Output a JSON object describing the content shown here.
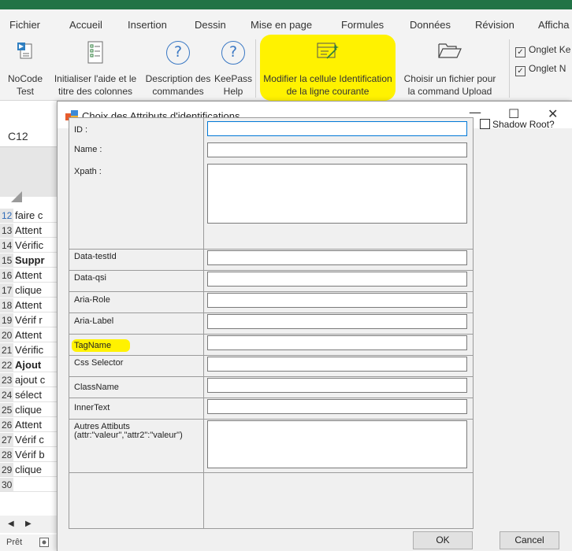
{
  "excel": {
    "menu_tabs": [
      "Fichier",
      "Accueil",
      "Insertion",
      "Dessin",
      "Mise en page",
      "Formules",
      "Données",
      "Révision",
      "Afficha"
    ],
    "ribbon": {
      "nocode_test": "NoCode\nTest",
      "init_help": "Initialiser l'aide et le\ntitre des colonnes",
      "desc_cmds": "Description des\ncommandes",
      "keepass_help": "KeePass\nHelp",
      "modify_cell": "Modifier la cellule Identification\nde la ligne courante",
      "choose_file": "Choisir un fichier pour\nla command Upload",
      "checkbox_1": "Onglet Ke",
      "checkbox_2": "Onglet N",
      "check_mark": "✓"
    },
    "name_box": "C12",
    "rows": [
      {
        "num": "12",
        "text": "faire c",
        "bold": false,
        "blue": true
      },
      {
        "num": "13",
        "text": "Attent",
        "bold": false,
        "blue": false
      },
      {
        "num": "14",
        "text": "Vérific",
        "bold": false,
        "blue": false
      },
      {
        "num": "15",
        "text": "Suppr",
        "bold": true,
        "blue": false
      },
      {
        "num": "16",
        "text": "Attent",
        "bold": false,
        "blue": false
      },
      {
        "num": "17",
        "text": "clique",
        "bold": false,
        "blue": false
      },
      {
        "num": "18",
        "text": "Attent",
        "bold": false,
        "blue": false
      },
      {
        "num": "19",
        "text": "Vérif r",
        "bold": false,
        "blue": false
      },
      {
        "num": "20",
        "text": "Attent",
        "bold": false,
        "blue": false
      },
      {
        "num": "21",
        "text": "Vérific",
        "bold": false,
        "blue": false
      },
      {
        "num": "22",
        "text": "Ajout",
        "bold": true,
        "blue": false
      },
      {
        "num": "23",
        "text": "ajout c",
        "bold": false,
        "blue": false
      },
      {
        "num": "24",
        "text": "sélect",
        "bold": false,
        "blue": false
      },
      {
        "num": "25",
        "text": "clique",
        "bold": false,
        "blue": false
      },
      {
        "num": "26",
        "text": "Attent",
        "bold": false,
        "blue": false
      },
      {
        "num": "27",
        "text": "Vérif c",
        "bold": false,
        "blue": false
      },
      {
        "num": "28",
        "text": "Vérif b",
        "bold": false,
        "blue": false
      },
      {
        "num": "29",
        "text": "clique",
        "bold": false,
        "blue": false
      },
      {
        "num": "30",
        "text": "",
        "bold": false,
        "blue": false
      }
    ],
    "sheet_nav_prev": "◀",
    "sheet_nav_next": "▶",
    "status_ready": "Prêt"
  },
  "dialog": {
    "title": "Choix des Attributs d'identifications",
    "minimize": "—",
    "maximize": "☐",
    "close": "✕",
    "fields": {
      "id": {
        "label": "ID :",
        "value": ""
      },
      "name": {
        "label": "Name :",
        "value": ""
      },
      "xpath": {
        "label": "Xpath :",
        "value": ""
      },
      "data_testid": {
        "label": "Data-testId",
        "value": ""
      },
      "data_qsi": {
        "label": "Data-qsi",
        "value": ""
      },
      "aria_role": {
        "label": "Aria-Role",
        "value": ""
      },
      "aria_label": {
        "label": "Aria-Label",
        "value": ""
      },
      "tagname": {
        "label": "TagName",
        "value": ""
      },
      "css_selector": {
        "label": "Css Selector",
        "value": ""
      },
      "classname": {
        "label": "ClassName",
        "value": ""
      },
      "innertext": {
        "label": "InnerText",
        "value": ""
      },
      "other": {
        "label_line1": "Autres Attibuts",
        "label_line2": "(attr:\"valeur\",\"attr2\":\"valeur\")",
        "value": ""
      }
    },
    "shadow_root": "Shadow Root?",
    "ok": "OK",
    "cancel": "Cancel"
  },
  "colors": {
    "excel_green": "#217346",
    "highlight_yellow": "#fff200",
    "focus_blue": "#0078d7",
    "icon_blue": "#3a78c4"
  }
}
